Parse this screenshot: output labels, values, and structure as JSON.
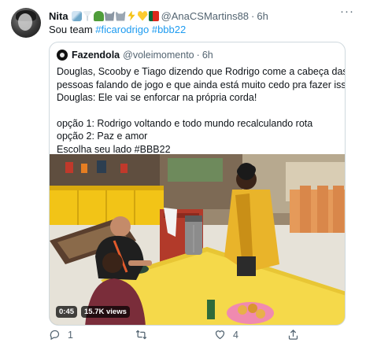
{
  "tweet": {
    "display_name": "Nita",
    "name_emojis": [
      "syringe",
      "cocktail",
      "cactus",
      "wolf",
      "wolf",
      "lightning",
      "yellow-heart",
      "portugal-flag"
    ],
    "handle": "@AnaCSMartins88",
    "separator": "·",
    "time": "6h",
    "text_prefix": "Sou team",
    "hashtag_1": "#ficarodrigo",
    "hashtag_2": "#bbb22"
  },
  "quote": {
    "name": "Fazendola",
    "handle": "@voleimomento",
    "separator": "·",
    "time": "6h",
    "lines": [
      "Douglas, Scooby e Tiago dizendo que Rodrigo come a cabeça das",
      "pessoas falando de jogo e que ainda está muito cedo pra fazer isso.",
      "Douglas: Ele vai se enforcar na própria corda!"
    ],
    "options": [
      "opção 1: Rodrigo voltando e todo mundo recalculando rota",
      "opção 2: Paz e amor",
      "Escolha seu lado #BBB22"
    ],
    "video": {
      "duration": "0:45",
      "views": "15.7K views"
    }
  },
  "actions": {
    "reply_count": "1",
    "retweet_count": "",
    "like_count": "4",
    "share_count": ""
  },
  "colors": {
    "link": "#1d9bf0",
    "secondary_text": "#536471",
    "border": "#cfd9de"
  }
}
